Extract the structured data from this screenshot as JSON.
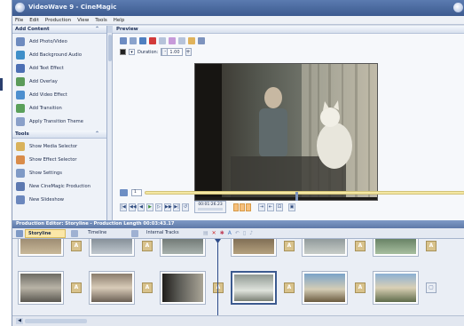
{
  "window": {
    "title": "VideoWave 9 - CineMagic"
  },
  "menu": [
    "File",
    "Edit",
    "Production",
    "View",
    "Tools",
    "Help"
  ],
  "add_content": {
    "header": "Add Content",
    "items": [
      {
        "label": "Add Photo/Video",
        "icon": "photo-video-icon",
        "color": "#6e8bbf"
      },
      {
        "label": "Add Background Audio",
        "icon": "audio-icon",
        "color": "#3f8fc9"
      },
      {
        "label": "Add Text Effect",
        "icon": "text-effect-icon",
        "color": "#4c6fb4"
      },
      {
        "label": "Add Overlay",
        "icon": "overlay-icon",
        "color": "#5b9b5a"
      },
      {
        "label": "Add Video Effect",
        "icon": "video-effect-icon",
        "color": "#4d8fcf"
      },
      {
        "label": "Add Transition",
        "icon": "transition-icon",
        "color": "#5aa05a"
      },
      {
        "label": "Apply Transition Theme",
        "icon": "transition-theme-icon",
        "color": "#8aa0c9"
      }
    ]
  },
  "tools": {
    "header": "Tools",
    "items": [
      {
        "label": "Show Media Selector",
        "icon": "media-selector-icon",
        "color": "#d9b25b"
      },
      {
        "label": "Show Effect Selector",
        "icon": "effect-selector-icon",
        "color": "#d98c4a"
      },
      {
        "label": "Show Settings",
        "icon": "settings-icon",
        "color": "#7f9ac6"
      },
      {
        "label": "New CineMagic Production",
        "icon": "cinemagic-icon",
        "color": "#5d79b1"
      },
      {
        "label": "New Slideshow",
        "icon": "slideshow-icon",
        "color": "#6b87bd"
      }
    ]
  },
  "preview": {
    "header": "Preview",
    "duration_label": "Duration:",
    "duration_value": "1.00",
    "minus": "-",
    "plus": "+",
    "frame_number": "1",
    "timecode": "00:01:26.23",
    "progress_fraction": 0.47
  },
  "production_editor": {
    "header": "Production Editor: Storyline - Production Length 00:03:43.17",
    "tabs": [
      "Storyline",
      "Timeline",
      "Internal Tracks"
    ]
  },
  "colors": {
    "title_bar": "#3c5a8f",
    "panel_bg": "#eef2f8",
    "accent_tab": "#fbe7a8",
    "scrub": "#f4e7a3"
  }
}
